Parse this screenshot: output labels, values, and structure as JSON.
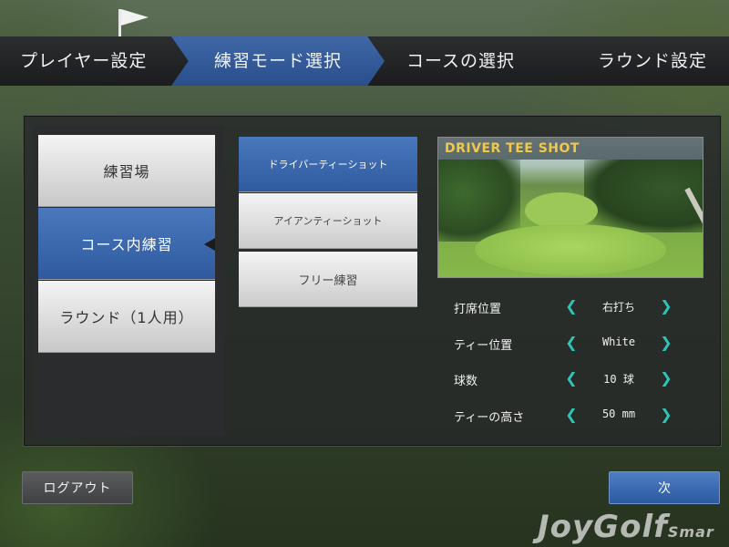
{
  "steps": [
    {
      "label": "プレイヤー設定"
    },
    {
      "label": "練習モード選択"
    },
    {
      "label": "コースの選択"
    },
    {
      "label": "ラウンド設定"
    }
  ],
  "modes": [
    {
      "label": "練習場"
    },
    {
      "label": "コース内練習"
    },
    {
      "label": "ラウンド（1人用）"
    }
  ],
  "sub_modes": [
    {
      "label": "ドライバーティーショット"
    },
    {
      "label": "アイアンティーショット"
    },
    {
      "label": "フリー練習"
    }
  ],
  "preview": {
    "title": "DRIVER TEE SHOT"
  },
  "settings": [
    {
      "label": "打席位置",
      "value": "右打ち"
    },
    {
      "label": "ティー位置",
      "value": "White"
    },
    {
      "label": "球数",
      "value": "10 球"
    },
    {
      "label": "ティーの高さ",
      "value": "50 mm"
    }
  ],
  "arrows": {
    "left": "❮",
    "right": "❯"
  },
  "buttons": {
    "logout": "ログアウト",
    "next": "次"
  },
  "logo": {
    "main": "JoyGolf",
    "sub": "Smar"
  },
  "colors": {
    "accent": "#2f5a9f",
    "arrow": "#2fc4b8",
    "preview_title": "#f0c84a"
  }
}
